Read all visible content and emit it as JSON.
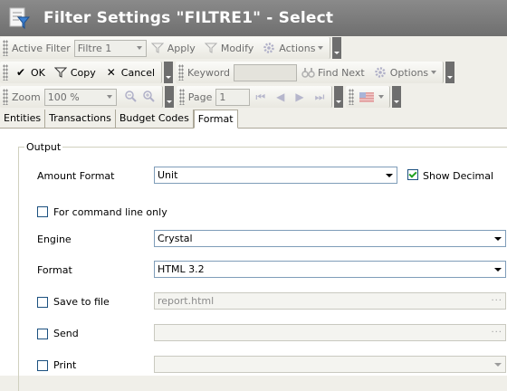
{
  "window": {
    "title": "Filter Settings \"FILTRE1\" - Select"
  },
  "toolbar1": {
    "active_filter_label": "Active Filter",
    "active_filter_value": "Filtre 1",
    "apply_label": "Apply",
    "modify_label": "Modify",
    "actions_label": "Actions"
  },
  "toolbar2": {
    "ok_label": "OK",
    "copy_label": "Copy",
    "cancel_label": "Cancel",
    "keyword_label": "Keyword",
    "keyword_value": "",
    "find_next_label": "Find Next",
    "options_label": "Options"
  },
  "toolbar3": {
    "zoom_label": "Zoom",
    "zoom_value": "100 %",
    "page_label": "Page",
    "page_value": "1"
  },
  "tabs": [
    {
      "label": "Entities"
    },
    {
      "label": "Transactions"
    },
    {
      "label": "Budget Codes"
    },
    {
      "label": "Format"
    }
  ],
  "output": {
    "group_label": "Output",
    "amount_format_label": "Amount Format",
    "amount_format_value": "Unit",
    "show_decimal_label": "Show Decimal",
    "show_decimal_checked": true,
    "command_line_label": "For command line only",
    "engine_label": "Engine",
    "engine_value": "Crystal",
    "format_label": "Format",
    "format_value": "HTML 3.2",
    "save_to_file_label": "Save to file",
    "save_to_file_value": "report.html",
    "send_label": "Send",
    "send_value": "",
    "print_label": "Print",
    "print_value": ""
  }
}
